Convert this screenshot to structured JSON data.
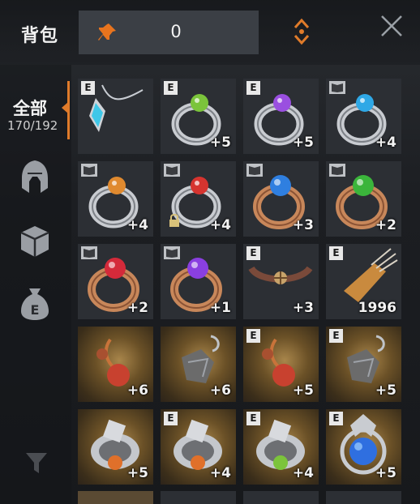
{
  "header": {
    "title": "背包",
    "pin_value": "0"
  },
  "sidebar": {
    "active_tab": {
      "label": "全部",
      "count": "170/192"
    },
    "tabs": [
      "helmet-icon",
      "box-icon",
      "money-bag-icon"
    ],
    "filter_icon": "filter-icon"
  },
  "items": [
    {
      "badge": "E",
      "book": false,
      "lock": false,
      "value": "",
      "kind": "necklace",
      "color": "#3ec7e8"
    },
    {
      "badge": "E",
      "book": false,
      "lock": false,
      "value": "+5",
      "kind": "ring-silver",
      "color": "#7bc43b"
    },
    {
      "badge": "E",
      "book": false,
      "lock": false,
      "value": "+5",
      "kind": "ring-silver",
      "color": "#9a4fe0"
    },
    {
      "badge": "",
      "book": true,
      "lock": false,
      "value": "+4",
      "kind": "ring-silver",
      "color": "#2fa8e6"
    },
    {
      "badge": "",
      "book": true,
      "lock": false,
      "value": "+4",
      "kind": "ring-silver",
      "color": "#e08a2f"
    },
    {
      "badge": "",
      "book": true,
      "lock": true,
      "value": "+4",
      "kind": "ring-silver",
      "color": "#d6342f"
    },
    {
      "badge": "",
      "book": true,
      "lock": false,
      "value": "+3",
      "kind": "ring-gold",
      "color": "#2f7fe0"
    },
    {
      "badge": "",
      "book": true,
      "lock": false,
      "value": "+2",
      "kind": "ring-gold",
      "color": "#3bb53b"
    },
    {
      "badge": "",
      "book": true,
      "lock": false,
      "value": "+2",
      "kind": "ring-gold",
      "color": "#d42a3a"
    },
    {
      "badge": "",
      "book": true,
      "lock": false,
      "value": "+1",
      "kind": "ring-gold",
      "color": "#8a3fe0"
    },
    {
      "badge": "E",
      "book": false,
      "lock": false,
      "value": "+3",
      "kind": "choker",
      "color": "#b8835a"
    },
    {
      "badge": "E",
      "book": false,
      "lock": false,
      "value": "1996",
      "kind": "quiver",
      "color": "#c98a3e"
    },
    {
      "badge": "",
      "book": false,
      "lock": false,
      "value": "+6",
      "kind": "earring-red",
      "color": "#c8412f",
      "glow": true
    },
    {
      "badge": "",
      "book": false,
      "lock": false,
      "value": "+6",
      "kind": "earring-dark",
      "color": "#6b6b6b",
      "glow": true
    },
    {
      "badge": "E",
      "book": false,
      "lock": false,
      "value": "+5",
      "kind": "earring-red",
      "color": "#c8412f",
      "glow": true
    },
    {
      "badge": "E",
      "book": false,
      "lock": false,
      "value": "+5",
      "kind": "earring-dark",
      "color": "#6b6b6b",
      "glow": true
    },
    {
      "badge": "",
      "book": false,
      "lock": false,
      "value": "+5",
      "kind": "belt",
      "color": "#e0702a",
      "glow": true
    },
    {
      "badge": "E",
      "book": false,
      "lock": false,
      "value": "+4",
      "kind": "belt",
      "color": "#e0702a",
      "glow": true
    },
    {
      "badge": "E",
      "book": false,
      "lock": false,
      "value": "+4",
      "kind": "belt",
      "color": "#7cc43b",
      "glow": true
    },
    {
      "badge": "E",
      "book": false,
      "lock": false,
      "value": "+5",
      "kind": "amulet-blue",
      "color": "#2f6fe0",
      "glow": true
    }
  ],
  "colors": {
    "accent": "#e07b2a",
    "slot_bg": "#2c2f34"
  }
}
